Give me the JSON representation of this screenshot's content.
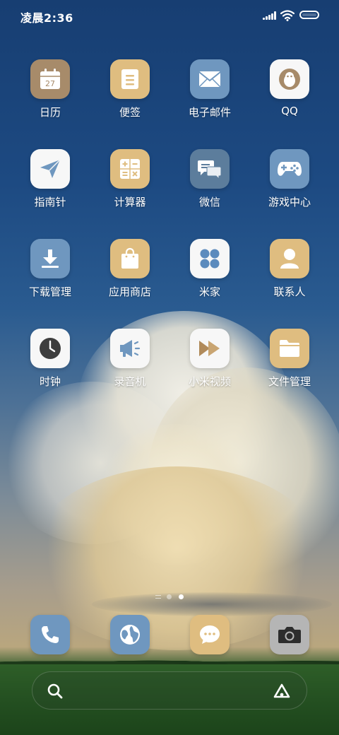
{
  "status_bar": {
    "time": "凌晨2:36"
  },
  "apps": [
    {
      "label": "日历",
      "icon": "calendar-icon",
      "calendar_day": "27",
      "color": "#a78b6a"
    },
    {
      "label": "便签",
      "icon": "notes-icon",
      "color": "#dfbd80"
    },
    {
      "label": "电子邮件",
      "icon": "mail-icon",
      "color": "#6f97bf"
    },
    {
      "label": "QQ",
      "icon": "qq-icon",
      "color": "#f7f7f7"
    },
    {
      "label": "指南针",
      "icon": "compass-icon",
      "color": "#f7f7f7"
    },
    {
      "label": "计算器",
      "icon": "calculator-icon",
      "color": "#dfbd80"
    },
    {
      "label": "微信",
      "icon": "wechat-icon",
      "color": "#5c7d9c"
    },
    {
      "label": "游戏中心",
      "icon": "gamepad-icon",
      "color": "#6f97bf"
    },
    {
      "label": "下载管理",
      "icon": "download-icon",
      "color": "#6f97bf"
    },
    {
      "label": "应用商店",
      "icon": "shopping-bag-icon",
      "color": "#dfbd80"
    },
    {
      "label": "米家",
      "icon": "mijia-icon",
      "color": "#f7f7f7"
    },
    {
      "label": "联系人",
      "icon": "contact-icon",
      "color": "#dfbd80"
    },
    {
      "label": "时钟",
      "icon": "clock-icon",
      "color": "#f7f7f7"
    },
    {
      "label": "录音机",
      "icon": "recorder-icon",
      "color": "#f7f7f7"
    },
    {
      "label": "小米视频",
      "icon": "video-icon",
      "color": "#f7f7f7"
    },
    {
      "label": "文件管理",
      "icon": "folder-icon",
      "color": "#dfbd80"
    }
  ],
  "page_indicator": {
    "pages": 3,
    "current": 2
  },
  "dock": [
    {
      "icon": "phone-icon",
      "color": "#6f97bf"
    },
    {
      "icon": "browser-icon",
      "color": "#6f97bf"
    },
    {
      "icon": "message-icon",
      "color": "#dfbd80"
    },
    {
      "icon": "camera-icon",
      "color": "#b5b5b5"
    }
  ],
  "search_bar": {
    "left_icon": "search-icon",
    "right_icon": "app-vault-icon"
  }
}
